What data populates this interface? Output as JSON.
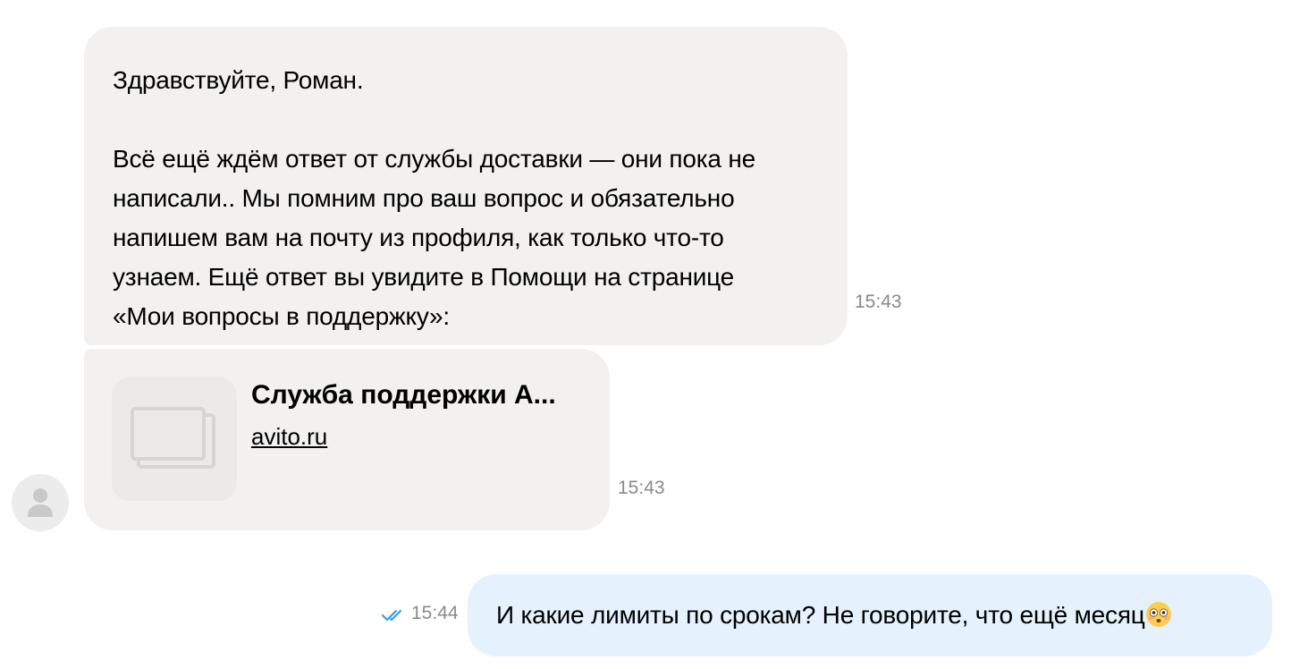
{
  "messages": {
    "incoming_1": {
      "text": "Здравствуйте, Роман.\n\nВсё ещё ждём ответ от службы доставки — они пока не\nнаписали.. Мы помним про ваш вопрос и обязательно\nнапишем вам на почту из профиля, как только что-то\nузнаем. Ещё ответ вы увидите в Помощи на странице\n«Мои вопросы в поддержку»:",
      "time": "15:43"
    },
    "incoming_link": {
      "title": "Служба поддержки А...",
      "url": "avito.ru",
      "thumbnail_icon": "image-placeholder-icon",
      "time": "15:43"
    },
    "outgoing_1": {
      "text": "И какие лимиты по срокам? Не говорите, что ещё месяц",
      "emoji": "flushed-face-icon",
      "time": "15:44",
      "status_icon": "double-check-icon",
      "status_color": "#3b9ce8"
    }
  },
  "avatar": {
    "icon": "user-silhouette-icon"
  },
  "colors": {
    "incoming_bubble": "#f2f1f0",
    "outgoing_bubble": "#e5f2fd",
    "timestamp": "#8a8a8a"
  }
}
